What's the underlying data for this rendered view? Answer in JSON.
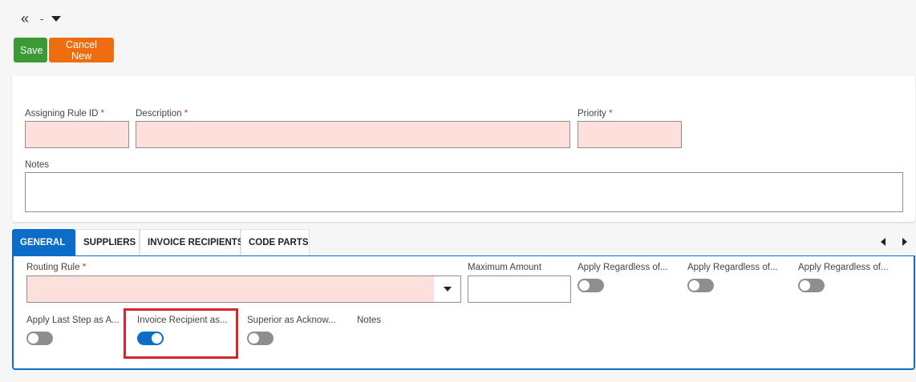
{
  "header": {
    "back_icon": "double-chevron-left-icon",
    "title": "-",
    "menu_icon": "caret-down-icon"
  },
  "toolbar": {
    "save_label": "Save",
    "cancel_label": "Cancel New"
  },
  "main_form": {
    "assigning_rule_id": {
      "label": "Assigning Rule ID",
      "required": "*",
      "value": ""
    },
    "description": {
      "label": "Description",
      "required": "*",
      "value": ""
    },
    "priority": {
      "label": "Priority",
      "required": "*",
      "value": ""
    },
    "notes": {
      "label": "Notes",
      "value": ""
    }
  },
  "tabs": [
    {
      "label": "GENERAL",
      "active": true
    },
    {
      "label": "SUPPLIERS",
      "active": false
    },
    {
      "label": "INVOICE RECIPIENTS",
      "active": false
    },
    {
      "label": "CODE PARTS",
      "active": false
    }
  ],
  "general": {
    "routing_rule": {
      "label": "Routing Rule",
      "required": "*",
      "value": ""
    },
    "maximum_amount": {
      "label": "Maximum Amount",
      "value": ""
    },
    "apply_regardless_1": {
      "label": "Apply Regardless of...",
      "on": false
    },
    "apply_regardless_2": {
      "label": "Apply Regardless of...",
      "on": false
    },
    "apply_regardless_3": {
      "label": "Apply Regardless of...",
      "on": false
    },
    "apply_last_step": {
      "label": "Apply Last Step as A...",
      "on": false
    },
    "invoice_recipient": {
      "label": "Invoice Recipient as...",
      "on": true
    },
    "superior_ack": {
      "label": "Superior as Acknow...",
      "on": false
    },
    "notes": {
      "label": "Notes"
    }
  },
  "colors": {
    "accent": "#0b6dc7",
    "save": "#3a9a35",
    "cancel": "#ef6d11",
    "required_field": "#fde0dc",
    "highlight_box": "#d3262d"
  }
}
